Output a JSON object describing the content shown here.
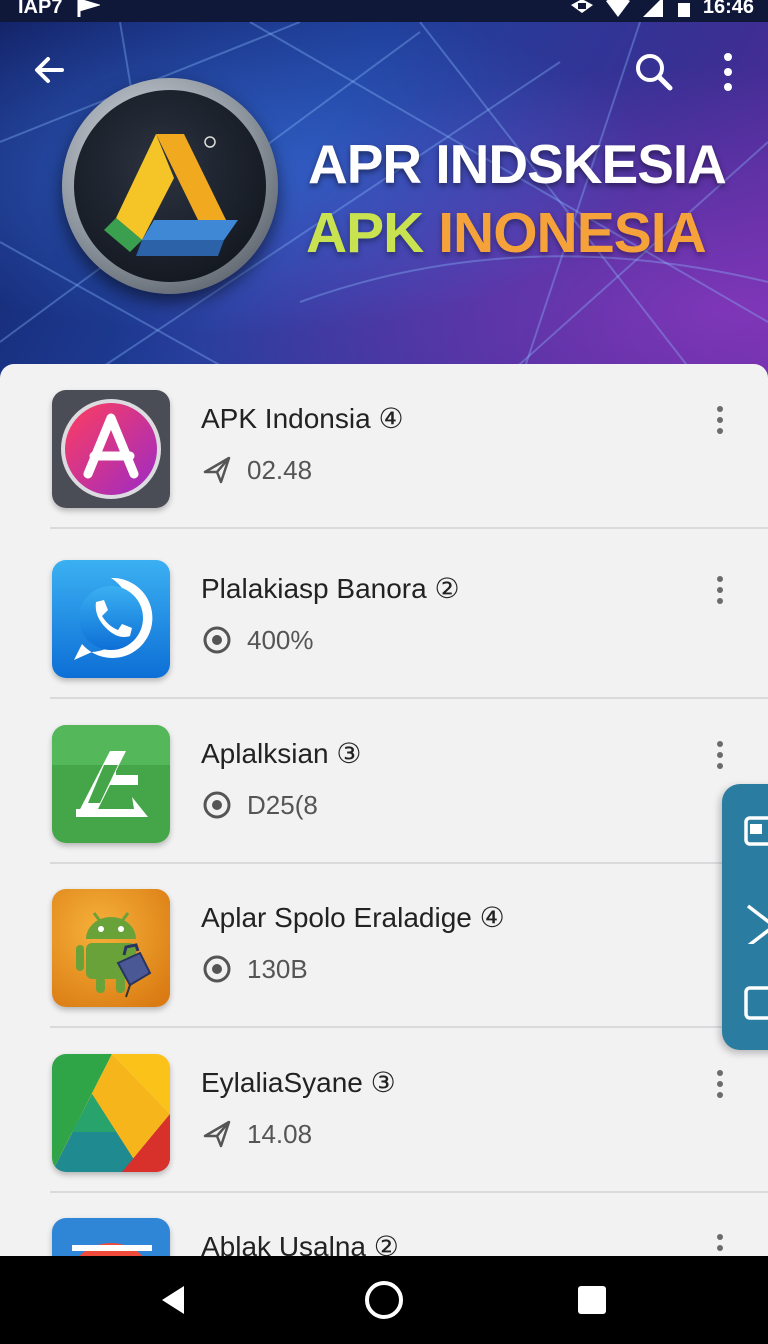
{
  "status_bar": {
    "carrier": "IAP7",
    "time": "16:46"
  },
  "header": {
    "banner_line1": "APR INDSKESIA",
    "banner_line2_part1": "APK ",
    "banner_line2_part2": "INONESIA",
    "back_icon": "arrow-left-icon",
    "search_icon": "search-icon",
    "more_icon": "more-vert-icon"
  },
  "apps": [
    {
      "name": "APK Indonsia",
      "badge": "④",
      "meta_icon": "send-icon",
      "meta": "02.48",
      "icon": "app-store-icon"
    },
    {
      "name": "Plalakiasp Banora",
      "badge": "②",
      "meta_icon": "target-icon",
      "meta": "400%",
      "icon": "whatsapp-icon"
    },
    {
      "name": "Aplalksian",
      "badge": "③",
      "meta_icon": "target-icon",
      "meta": "D25(8",
      "icon": "green-a-icon"
    },
    {
      "name": "Aplar Spolo Eraladige",
      "badge": "④",
      "meta_icon": "target-icon",
      "meta": "130B",
      "icon": "android-icon"
    },
    {
      "name": "EylaliaSyane",
      "badge": "③",
      "meta_icon": "send-icon",
      "meta": "14.08",
      "icon": "triangle-colors-icon"
    },
    {
      "name": "Ablak Usalna",
      "badge": "②",
      "meta_icon": "target-icon",
      "meta": "",
      "icon": "colorful-icon"
    }
  ],
  "colors": {
    "header_start": "#14246a",
    "header_end": "#5a2a9a",
    "list_bg": "#f2f2f3",
    "side_panel": "#2a7da0"
  },
  "nav": {
    "back": "nav-back-icon",
    "home": "nav-home-icon",
    "recents": "nav-recents-icon"
  }
}
